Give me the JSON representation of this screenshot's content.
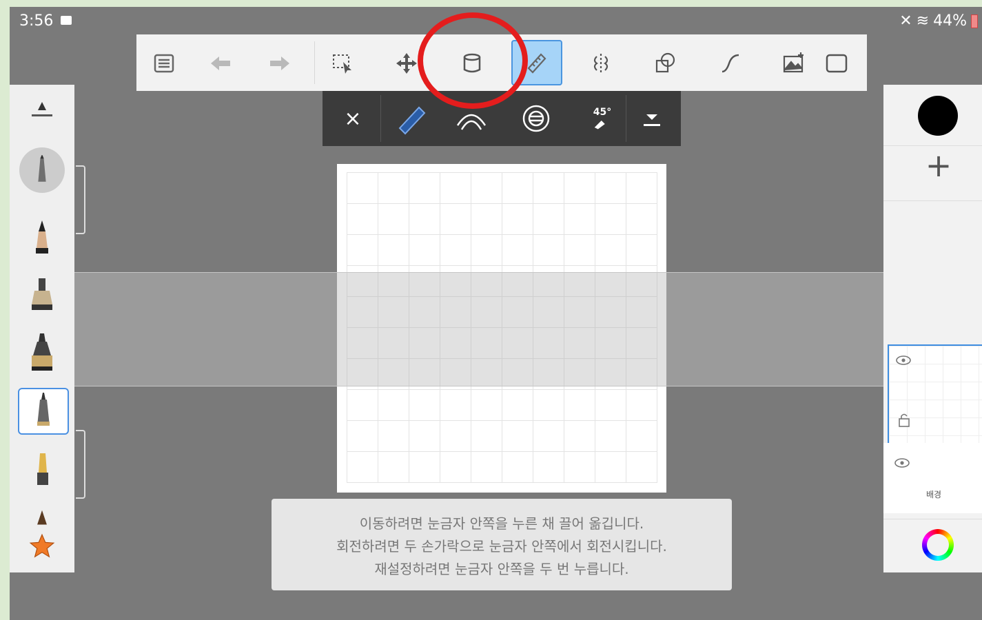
{
  "status_bar": {
    "time": "3:56",
    "battery": "44%"
  },
  "toolbar": {
    "items": [
      "list-icon",
      "undo-icon",
      "redo-icon",
      "selection-icon",
      "transform-icon",
      "fill-bucket-icon",
      "ruler-guides-icon",
      "symmetry-icon",
      "shapes-icon",
      "curve-icon",
      "add-image-icon",
      "fullscreen-icon"
    ],
    "active": "ruler-guides-icon"
  },
  "ruler_toolbar": {
    "close_label": "×",
    "angle_label": "45°",
    "items": [
      "close-icon",
      "straight-ruler-icon",
      "curve-ruler-icon",
      "ellipse-ruler-icon",
      "angle-snap-icon",
      "more-dropdown-icon"
    ]
  },
  "hint": {
    "line1": "이동하려면 눈금자 안쪽을 누른 채 끌어 옮깁니다.",
    "line2": "회전하려면 두 손가락으로 눈금자 안쪽에서 회전시킵니다.",
    "line3": "재설정하려면 눈금자 안쪽을 두 번 누릅니다."
  },
  "layers": {
    "add_label": "+",
    "background_name": "배경"
  },
  "colors": {
    "current_color": "#000000",
    "accent": "#4a95e0",
    "highlight_circle": "#e41d1d"
  }
}
